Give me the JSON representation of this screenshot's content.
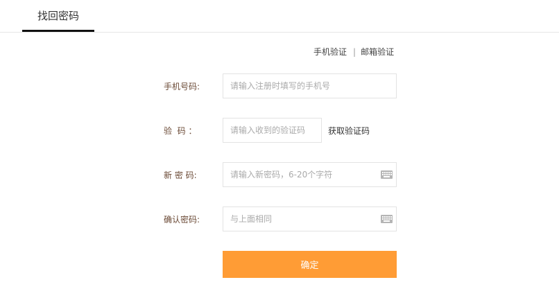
{
  "header": {
    "tab_label": "找回密码"
  },
  "verify_switch": {
    "phone": "手机验证",
    "separator": "|",
    "email": "邮箱验证"
  },
  "form": {
    "phone": {
      "label": "手机号码:",
      "placeholder": "请输入注册时填写的手机号"
    },
    "code": {
      "label": "验  码 ：",
      "placeholder": "请输入收到的验证码",
      "get_code": "获取验证码"
    },
    "new_password": {
      "label": "新 密 码:",
      "placeholder": "请输入新密码，6-20个字符",
      "icon": "keyboard-icon"
    },
    "confirm_password": {
      "label": "确认密码:",
      "placeholder": "与上面相同",
      "icon": "keyboard-icon"
    },
    "submit_label": "确定"
  },
  "colors": {
    "accent": "#ff9c35",
    "label": "#6b4a36",
    "border": "#e3e3e3"
  }
}
